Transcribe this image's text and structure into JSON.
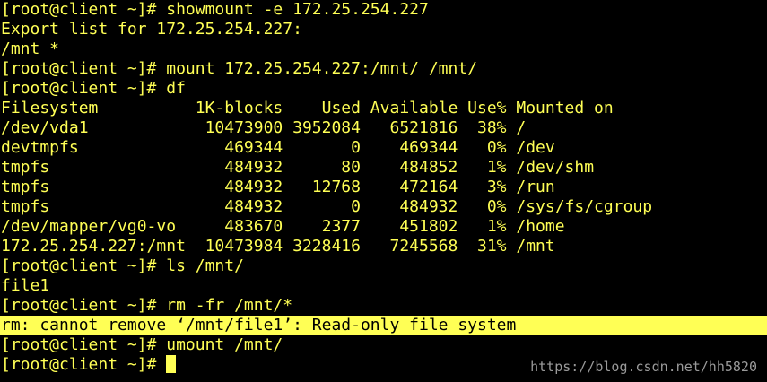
{
  "colors": {
    "background": "#000000",
    "text": "#ffff55",
    "highlight_background": "#ffff55",
    "highlight_text": "#000000",
    "watermark": "#9a9a9a"
  },
  "terminal": {
    "lines": [
      "[root@client ~]# showmount -e 172.25.254.227",
      "Export list for 172.25.254.227:",
      "/mnt *",
      "[root@client ~]# mount 172.25.254.227:/mnt/ /mnt/",
      "[root@client ~]# df",
      "Filesystem          1K-blocks    Used Available Use% Mounted on",
      "/dev/vda1            10473900 3952084   6521816  38% /",
      "devtmpfs               469344       0    469344   0% /dev",
      "tmpfs                  484932      80    484852   1% /dev/shm",
      "tmpfs                  484932   12768    472164   3% /run",
      "tmpfs                  484932       0    484932   0% /sys/fs/cgroup",
      "/dev/mapper/vg0-vo     483670    2377    451802   1% /home",
      "172.25.254.227:/mnt  10473984 3228416   7245568  31% /mnt",
      "[root@client ~]# ls /mnt/",
      "file1",
      "[root@client ~]# rm -fr /mnt/*",
      "rm: cannot remove ‘/mnt/file1’: Read-only file system",
      "[root@client ~]# umount /mnt/"
    ],
    "prompt": "[root@client ~]# "
  },
  "watermark": "https://blog.csdn.net/hh5820"
}
